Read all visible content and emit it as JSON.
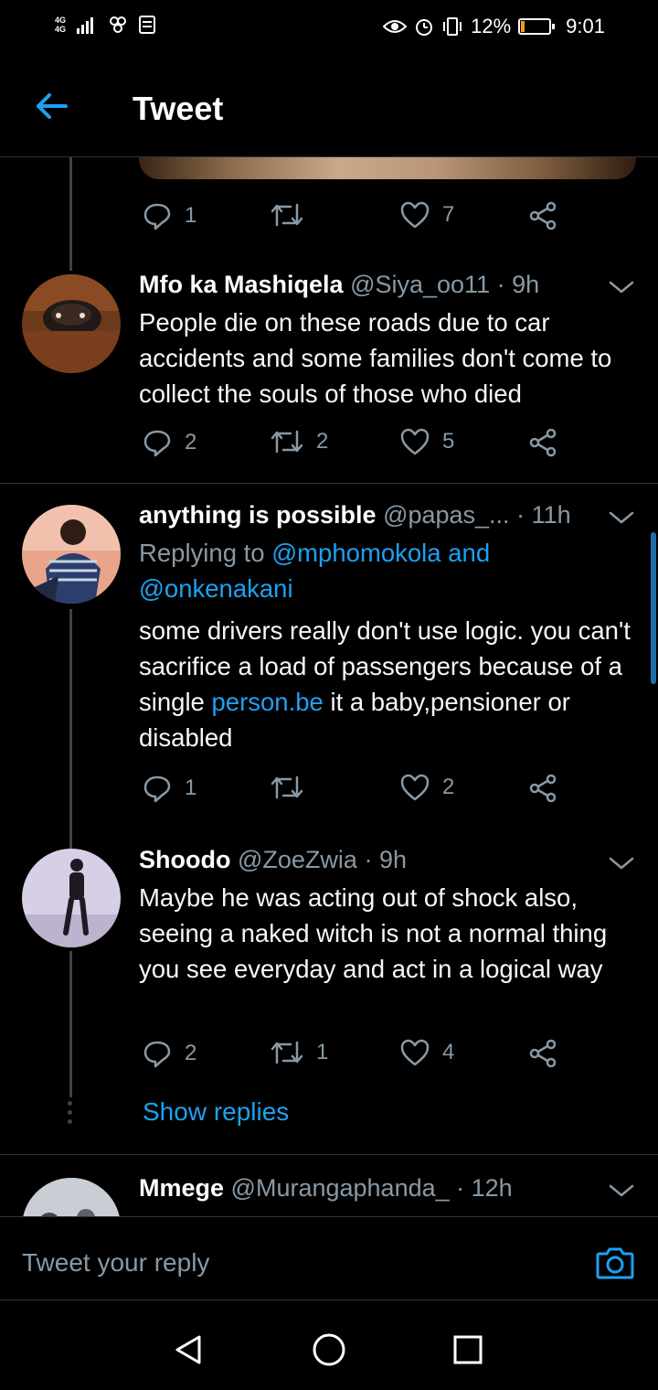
{
  "status_bar": {
    "network_top": "4G",
    "network_bottom": "4G",
    "battery": "12%",
    "battery_level": 0.12,
    "time": "9:01"
  },
  "header": {
    "title": "Tweet"
  },
  "top_actions": {
    "replies": "1",
    "retweets": "",
    "likes": "7"
  },
  "tweets": [
    {
      "name": "Mfo ka Mashiqela",
      "handle": "@Siya_oo11",
      "time": "· 9h",
      "text": "People die on these roads due to car accidents and some families don't come to collect the souls of those who died",
      "replies": "2",
      "retweets": "2",
      "likes": "5"
    },
    {
      "name": "anything is possible",
      "handle": "@papas_...",
      "time": "· 11h",
      "replying_prefix": "Replying to ",
      "replying_users": "@mphomokola and @onkenakani",
      "text_part1": "some drivers really don't use logic. you can't sacrifice a load of passengers because of a single ",
      "text_link": "person.be",
      "text_part2": " it a baby,pensioner or disabled",
      "replies": "1",
      "retweets": "",
      "likes": "2"
    },
    {
      "name": "Shoodo",
      "handle": "@ZoeZwia",
      "time": "· 9h",
      "text": "Maybe he was acting out of shock also, seeing a naked witch is not a normal thing you see everyday and act in a logical way",
      "replies": "2",
      "retweets": "1",
      "likes": "4",
      "show_replies": "Show replies"
    },
    {
      "name": "Mmege",
      "handle": "@Murangaphanda_",
      "time": "· 12h"
    }
  ],
  "composer": {
    "placeholder": "Tweet your reply"
  },
  "icons": {
    "back": "arrow-left-icon",
    "reply": "comment-bubble-icon",
    "retweet": "retweet-icon",
    "like": "heart-icon",
    "share": "share-icon",
    "caret": "chevron-down-icon",
    "camera": "camera-icon"
  },
  "colors": {
    "background": "#000000",
    "accent": "#1da1f2",
    "muted": "#8899a6",
    "battery": "#f59c1a"
  }
}
